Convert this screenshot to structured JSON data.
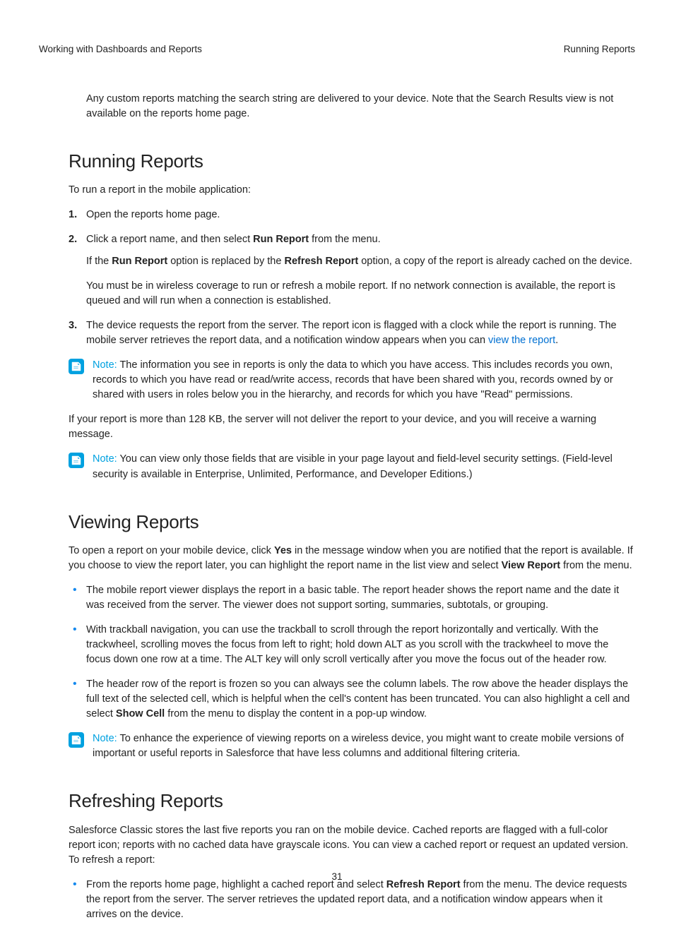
{
  "header": {
    "left": "Working with Dashboards and Reports",
    "right": "Running Reports"
  },
  "intro": "Any custom reports matching the search string are delivered to your device. Note that the Search Results view is not available on the reports home page.",
  "running": {
    "title": "Running Reports",
    "lead": "To run a report in the mobile application:",
    "step1": "Open the reports home page.",
    "step2_pre": "Click a report name, and then select ",
    "step2_bold": "Run Report",
    "step2_post": " from the menu.",
    "step2_p1_a": "If the ",
    "step2_p1_b1": "Run Report",
    "step2_p1_b": " option is replaced by the ",
    "step2_p1_b2": "Refresh Report",
    "step2_p1_c": " option, a copy of the report is already cached on the device.",
    "step2_p2": "You must be in wireless coverage to run or refresh a mobile report. If no network connection is available, the report is queued and will run when a connection is established.",
    "step3_pre": "The device requests the report from the server. The report icon is flagged with a clock while the report is running. The mobile server retrieves the report data, and a notification window appears when you can ",
    "step3_link": "view the report",
    "step3_post": ".",
    "note1_label": "Note:",
    "note1_body": "  The information you see in reports is only the data to which you have access. This includes records you own, records to which you have read or read/write access, records that have been shared with you, records owned by or shared with users in roles below you in the hierarchy, and records for which you have \"Read\" permissions.",
    "size_para": "If your report is more than 128 KB, the server will not deliver the report to your device, and you will receive a warning message.",
    "note2_label": "Note:",
    "note2_body": "  You can view only those fields that are visible in your page layout and field-level security settings. (Field-level security is available in Enterprise, Unlimited, Performance, and Developer Editions.)"
  },
  "viewing": {
    "title": "Viewing Reports",
    "lead_a": "To open a report on your mobile device, click ",
    "lead_b1": "Yes",
    "lead_b": " in the message window when you are notified that the report is available. If you choose to view the report later, you can highlight the report name in the list view and select ",
    "lead_b2": "View Report",
    "lead_c": " from the menu.",
    "b1": "The mobile report viewer displays the report in a basic table. The report header shows the report name and the date it was received from the server. The viewer does not support sorting, summaries, subtotals, or grouping.",
    "b2": "With trackball navigation, you can use the trackball to scroll through the report horizontally and vertically. With the trackwheel, scrolling moves the focus from left to right; hold down ALT as you scroll with the trackwheel to move the focus down one row at a time. The ALT key will only scroll vertically after you move the focus out of the header row.",
    "b3_a": "The header row of the report is frozen so you can always see the column labels. The row above the header displays the full text of the selected cell, which is helpful when the cell's content has been truncated. You can also highlight a cell and select ",
    "b3_bold": "Show Cell",
    "b3_b": " from the menu to display the content in a pop-up window.",
    "note_label": "Note:",
    "note_body": "  To enhance the experience of viewing reports on a wireless device, you might want to create mobile versions of important or useful reports in Salesforce that have less columns and additional filtering criteria."
  },
  "refreshing": {
    "title": "Refreshing Reports",
    "lead": "Salesforce Classic stores the last five reports you ran on the mobile device. Cached reports are flagged with a full-color report icon; reports with no cached data have grayscale icons. You can view a cached report or request an updated version. To refresh a report:",
    "b1_a": "From the reports home page, highlight a cached report and select ",
    "b1_bold": "Refresh Report",
    "b1_b": " from the menu. The device requests the report from the server. The server retrieves the updated report data, and a notification window appears when it arrives on the device."
  },
  "footer": "31"
}
